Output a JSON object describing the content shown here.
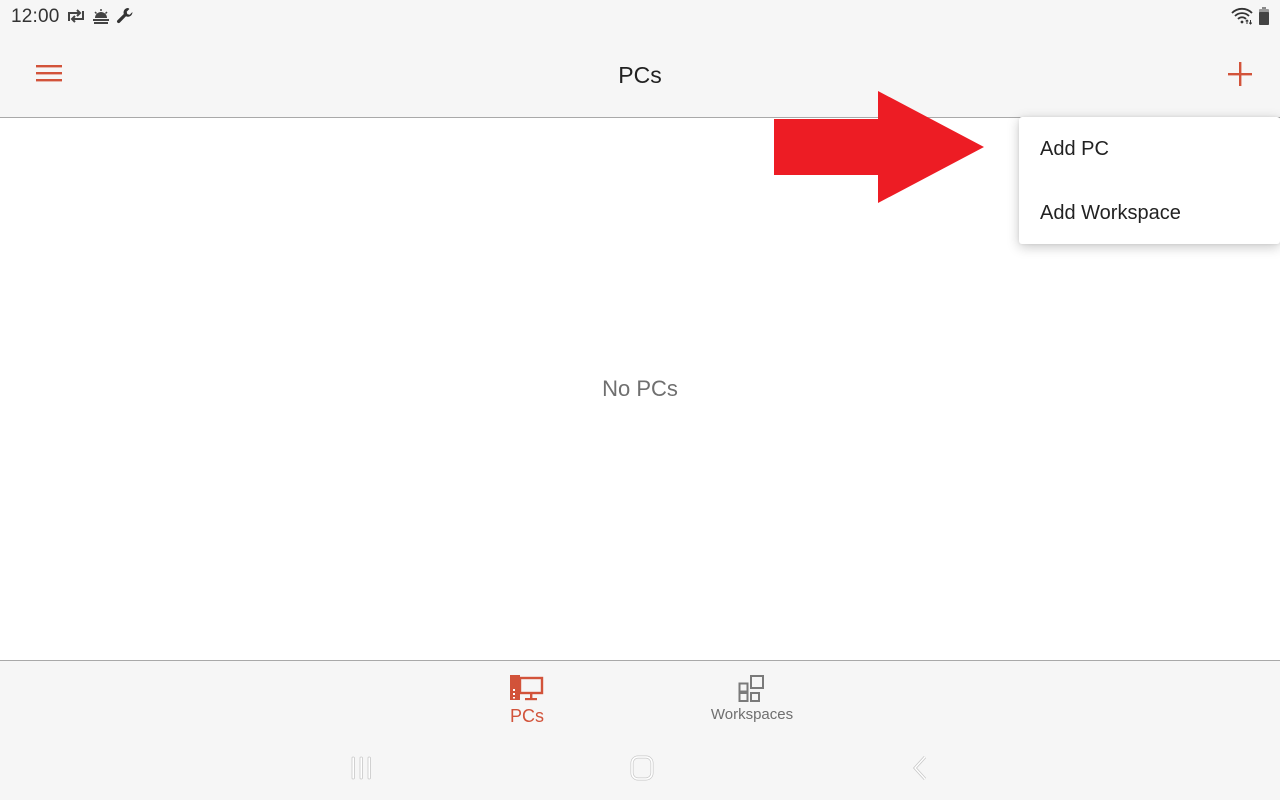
{
  "status_bar": {
    "time": "12:00",
    "left_icons": [
      "sync-icon",
      "weather-sunrise-icon",
      "wrench-icon"
    ],
    "right_icons": [
      "wifi-icon",
      "battery-icon"
    ]
  },
  "app_bar": {
    "title": "PCs",
    "menu_icon": "hamburger-menu-icon",
    "add_icon": "plus-icon"
  },
  "main": {
    "empty_message": "No PCs"
  },
  "add_menu": {
    "items": [
      {
        "label": "Add PC"
      },
      {
        "label": "Add Workspace"
      }
    ]
  },
  "annotation": {
    "type": "arrow",
    "direction": "right",
    "color": "#ed1c24"
  },
  "bottom_nav": {
    "tabs": [
      {
        "label": "PCs",
        "icon": "desktop-pc-icon",
        "active": true
      },
      {
        "label": "Workspaces",
        "icon": "workspaces-grid-icon",
        "active": false
      }
    ]
  },
  "system_nav": {
    "buttons": [
      "recents",
      "home",
      "back"
    ]
  },
  "colors": {
    "accent": "#d2533a",
    "bar_background": "#f6f6f6",
    "inactive": "#6f6f6f"
  }
}
